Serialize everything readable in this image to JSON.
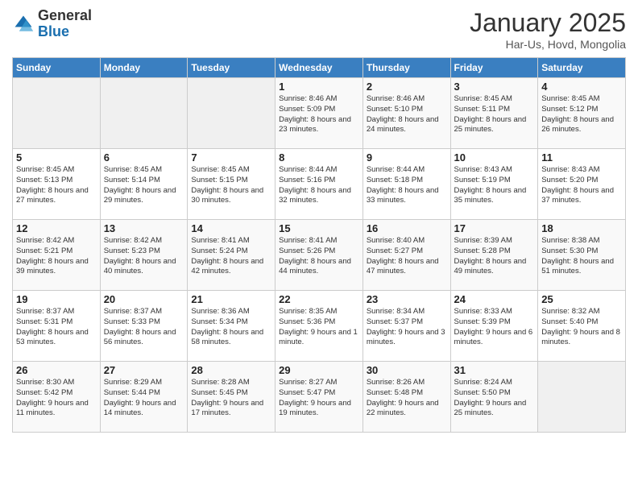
{
  "header": {
    "logo_general": "General",
    "logo_blue": "Blue",
    "month_year": "January 2025",
    "location": "Har-Us, Hovd, Mongolia"
  },
  "days_of_week": [
    "Sunday",
    "Monday",
    "Tuesday",
    "Wednesday",
    "Thursday",
    "Friday",
    "Saturday"
  ],
  "weeks": [
    [
      {
        "day": "",
        "info": ""
      },
      {
        "day": "",
        "info": ""
      },
      {
        "day": "",
        "info": ""
      },
      {
        "day": "1",
        "info": "Sunrise: 8:46 AM\nSunset: 5:09 PM\nDaylight: 8 hours\nand 23 minutes."
      },
      {
        "day": "2",
        "info": "Sunrise: 8:46 AM\nSunset: 5:10 PM\nDaylight: 8 hours\nand 24 minutes."
      },
      {
        "day": "3",
        "info": "Sunrise: 8:45 AM\nSunset: 5:11 PM\nDaylight: 8 hours\nand 25 minutes."
      },
      {
        "day": "4",
        "info": "Sunrise: 8:45 AM\nSunset: 5:12 PM\nDaylight: 8 hours\nand 26 minutes."
      }
    ],
    [
      {
        "day": "5",
        "info": "Sunrise: 8:45 AM\nSunset: 5:13 PM\nDaylight: 8 hours\nand 27 minutes."
      },
      {
        "day": "6",
        "info": "Sunrise: 8:45 AM\nSunset: 5:14 PM\nDaylight: 8 hours\nand 29 minutes."
      },
      {
        "day": "7",
        "info": "Sunrise: 8:45 AM\nSunset: 5:15 PM\nDaylight: 8 hours\nand 30 minutes."
      },
      {
        "day": "8",
        "info": "Sunrise: 8:44 AM\nSunset: 5:16 PM\nDaylight: 8 hours\nand 32 minutes."
      },
      {
        "day": "9",
        "info": "Sunrise: 8:44 AM\nSunset: 5:18 PM\nDaylight: 8 hours\nand 33 minutes."
      },
      {
        "day": "10",
        "info": "Sunrise: 8:43 AM\nSunset: 5:19 PM\nDaylight: 8 hours\nand 35 minutes."
      },
      {
        "day": "11",
        "info": "Sunrise: 8:43 AM\nSunset: 5:20 PM\nDaylight: 8 hours\nand 37 minutes."
      }
    ],
    [
      {
        "day": "12",
        "info": "Sunrise: 8:42 AM\nSunset: 5:21 PM\nDaylight: 8 hours\nand 39 minutes."
      },
      {
        "day": "13",
        "info": "Sunrise: 8:42 AM\nSunset: 5:23 PM\nDaylight: 8 hours\nand 40 minutes."
      },
      {
        "day": "14",
        "info": "Sunrise: 8:41 AM\nSunset: 5:24 PM\nDaylight: 8 hours\nand 42 minutes."
      },
      {
        "day": "15",
        "info": "Sunrise: 8:41 AM\nSunset: 5:26 PM\nDaylight: 8 hours\nand 44 minutes."
      },
      {
        "day": "16",
        "info": "Sunrise: 8:40 AM\nSunset: 5:27 PM\nDaylight: 8 hours\nand 47 minutes."
      },
      {
        "day": "17",
        "info": "Sunrise: 8:39 AM\nSunset: 5:28 PM\nDaylight: 8 hours\nand 49 minutes."
      },
      {
        "day": "18",
        "info": "Sunrise: 8:38 AM\nSunset: 5:30 PM\nDaylight: 8 hours\nand 51 minutes."
      }
    ],
    [
      {
        "day": "19",
        "info": "Sunrise: 8:37 AM\nSunset: 5:31 PM\nDaylight: 8 hours\nand 53 minutes."
      },
      {
        "day": "20",
        "info": "Sunrise: 8:37 AM\nSunset: 5:33 PM\nDaylight: 8 hours\nand 56 minutes."
      },
      {
        "day": "21",
        "info": "Sunrise: 8:36 AM\nSunset: 5:34 PM\nDaylight: 8 hours\nand 58 minutes."
      },
      {
        "day": "22",
        "info": "Sunrise: 8:35 AM\nSunset: 5:36 PM\nDaylight: 9 hours\nand 1 minute."
      },
      {
        "day": "23",
        "info": "Sunrise: 8:34 AM\nSunset: 5:37 PM\nDaylight: 9 hours\nand 3 minutes."
      },
      {
        "day": "24",
        "info": "Sunrise: 8:33 AM\nSunset: 5:39 PM\nDaylight: 9 hours\nand 6 minutes."
      },
      {
        "day": "25",
        "info": "Sunrise: 8:32 AM\nSunset: 5:40 PM\nDaylight: 9 hours\nand 8 minutes."
      }
    ],
    [
      {
        "day": "26",
        "info": "Sunrise: 8:30 AM\nSunset: 5:42 PM\nDaylight: 9 hours\nand 11 minutes."
      },
      {
        "day": "27",
        "info": "Sunrise: 8:29 AM\nSunset: 5:44 PM\nDaylight: 9 hours\nand 14 minutes."
      },
      {
        "day": "28",
        "info": "Sunrise: 8:28 AM\nSunset: 5:45 PM\nDaylight: 9 hours\nand 17 minutes."
      },
      {
        "day": "29",
        "info": "Sunrise: 8:27 AM\nSunset: 5:47 PM\nDaylight: 9 hours\nand 19 minutes."
      },
      {
        "day": "30",
        "info": "Sunrise: 8:26 AM\nSunset: 5:48 PM\nDaylight: 9 hours\nand 22 minutes."
      },
      {
        "day": "31",
        "info": "Sunrise: 8:24 AM\nSunset: 5:50 PM\nDaylight: 9 hours\nand 25 minutes."
      },
      {
        "day": "",
        "info": ""
      }
    ]
  ]
}
